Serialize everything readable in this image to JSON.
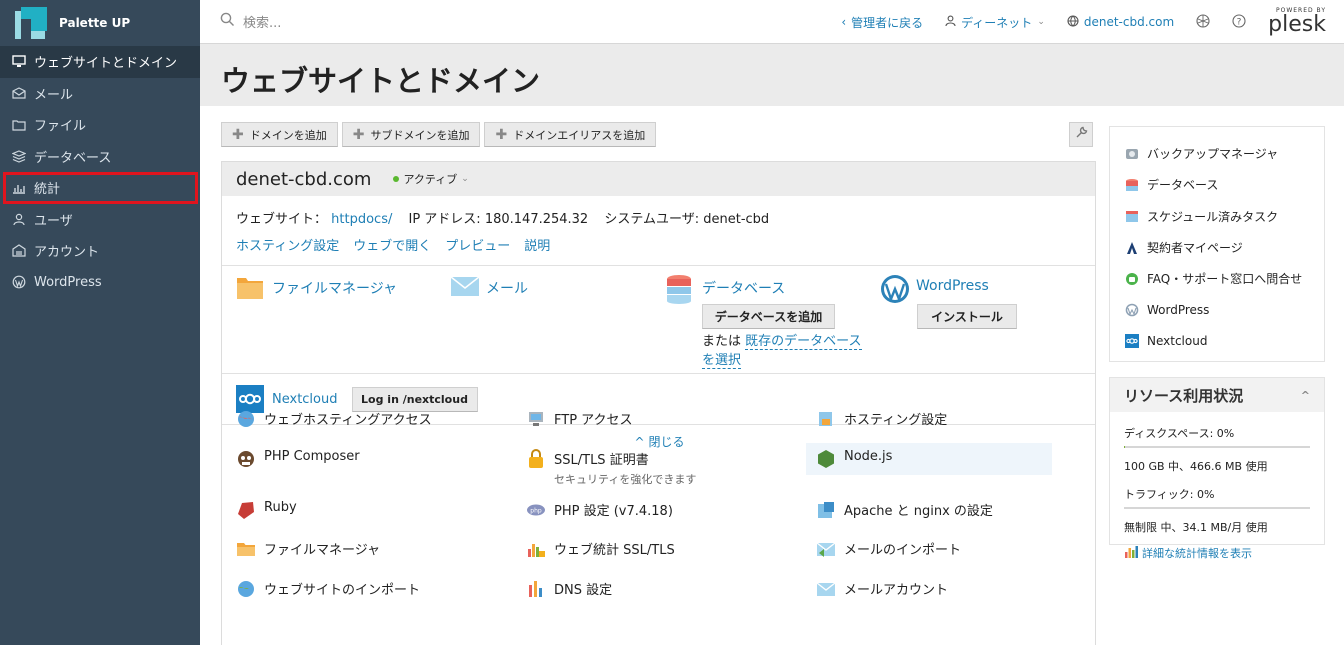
{
  "brand": {
    "name": "Palette UP",
    "accent": "#21b0c4"
  },
  "sidebar": {
    "items": [
      {
        "label": "ウェブサイトとドメイン",
        "icon": "monitor-icon",
        "active": true
      },
      {
        "label": "メール",
        "icon": "mail-icon"
      },
      {
        "label": "ファイル",
        "icon": "folder-icon"
      },
      {
        "label": "データベース",
        "icon": "database-icon"
      },
      {
        "label": "統計",
        "icon": "bar-chart-icon",
        "highlighted": true
      },
      {
        "label": "ユーザ",
        "icon": "user-icon"
      },
      {
        "label": "アカウント",
        "icon": "account-icon"
      },
      {
        "label": "WordPress",
        "icon": "wordpress-icon"
      }
    ],
    "highlight_color": "#e0141e"
  },
  "header": {
    "search_placeholder": "検索...",
    "back_label": "管理者に戻る",
    "user_label": "ディーネット",
    "domain_link": "denet-cbd.com",
    "powered_by": "POWERED BY",
    "plesk": "plesk"
  },
  "page": {
    "title": "ウェブサイトとドメイン"
  },
  "toolbar": {
    "add_domain": "ドメインを追加",
    "add_subdomain": "サブドメインを追加",
    "add_alias": "ドメインエイリアスを追加"
  },
  "domain": {
    "name": "denet-cbd.com",
    "status": "アクティブ",
    "website_label": "ウェブサイト：",
    "website_link": "httpdocs/",
    "ip_label": "IP アドレス:",
    "ip": "180.147.254.32",
    "sysuser_label": "システムユーザ:",
    "sysuser": "denet-cbd",
    "links": [
      "ホスティング設定",
      "ウェブで開く",
      "プレビュー",
      "説明"
    ]
  },
  "quick": {
    "file_manager": "ファイルマネージャ",
    "mail": "メール",
    "database": "データベース",
    "add_db": "データベースを追加",
    "or": "または",
    "select_db": "既存のデータベースを選択",
    "wordpress": "WordPress",
    "install": "インストール",
    "nextcloud": "Nextcloud",
    "nextcloud_login": "Log in /nextcloud",
    "close": "閉じる"
  },
  "tools": [
    {
      "label": "ウェブホスティングアクセス",
      "icon": "globe-user-icon"
    },
    {
      "label": "FTP アクセス",
      "icon": "ftp-icon"
    },
    {
      "label": "ホスティング設定",
      "icon": "hosting-settings-icon"
    },
    {
      "label": "PHP Composer",
      "icon": "composer-icon"
    },
    {
      "label": "SSL/TLS 証明書",
      "sub": "セキュリティを強化できます",
      "icon": "lock-icon"
    },
    {
      "label": "Node.js",
      "icon": "nodejs-icon"
    },
    {
      "label": "Ruby",
      "icon": "ruby-icon"
    },
    {
      "label": "PHP 設定 (v7.4.18)",
      "icon": "php-icon"
    },
    {
      "label": "Apache と nginx の設定",
      "icon": "apache-icon"
    },
    {
      "label": "ファイルマネージャ",
      "icon": "folder-icon"
    },
    {
      "label": "ウェブ統計 SSL/TLS",
      "icon": "stats-lock-icon"
    },
    {
      "label": "メールのインポート",
      "icon": "mail-import-icon"
    },
    {
      "label": "ウェブサイトのインポート",
      "icon": "globe-import-icon"
    },
    {
      "label": "DNS 設定",
      "icon": "dns-icon"
    },
    {
      "label": "メールアカウント",
      "icon": "mail-account-icon"
    }
  ],
  "right_links": [
    {
      "label": "バックアップマネージャ",
      "icon": "backup-icon"
    },
    {
      "label": "データベース",
      "icon": "database-icon"
    },
    {
      "label": "スケジュール済みタスク",
      "icon": "calendar-icon"
    },
    {
      "label": "契約者マイページ",
      "icon": "mypage-icon"
    },
    {
      "label": "FAQ・サポート窓口へ問合せ",
      "icon": "support-icon"
    },
    {
      "label": "WordPress",
      "icon": "wordpress-icon"
    },
    {
      "label": "Nextcloud",
      "icon": "nextcloud-icon"
    }
  ],
  "resources": {
    "title": "リソース利用状況",
    "disk_label": "ディスクスペース: 0%",
    "disk_detail": "100 GB 中、466.6 MB 使用",
    "disk_fraction": 0.005,
    "traffic_label": "トラフィック: 0%",
    "traffic_detail": "無制限 中、34.1 MB/月 使用",
    "traffic_fraction": 0.0,
    "stats_link": "詳細な統計情報を表示"
  }
}
